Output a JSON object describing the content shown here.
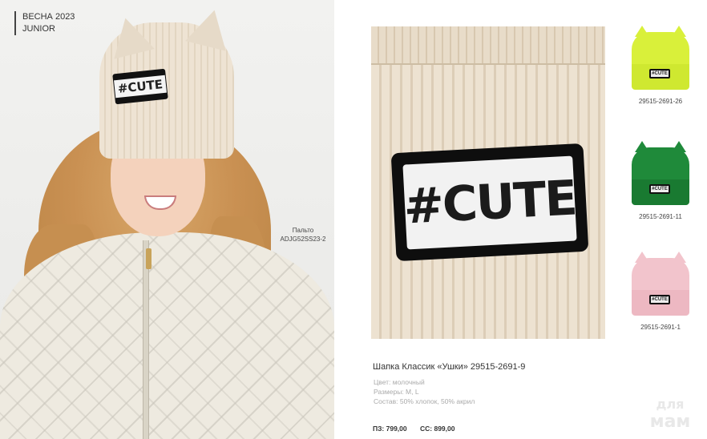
{
  "season": {
    "line1": "ВЕСНА 2023",
    "line2": "JUNIOR"
  },
  "coat_label": {
    "line1": "Пальто",
    "line2": "ADJG52SS23-2"
  },
  "hat_patch_text": "#CUTE",
  "detail_patch_text": "#CUTE",
  "product": {
    "title": "Шапка Классик «Ушки» 29515-2691-9",
    "color": "Цвет: молочный",
    "sizes": "Размеры: M, L",
    "composition": "Состав: 50% хлопок, 50% акрил",
    "price_pz": "ПЗ: 799,00",
    "price_ss": "СС: 899,00"
  },
  "variants": [
    {
      "code": "29515-2691-26",
      "color": "#d9f03a",
      "cuff_color": "#cfe830",
      "patch": "#CUTE"
    },
    {
      "code": "29515-2691-11",
      "color": "#1f8a3a",
      "cuff_color": "#197a31",
      "patch": "#CUTE"
    },
    {
      "code": "29515-2691-1",
      "color": "#f2c4cc",
      "cuff_color": "#edb8c2",
      "patch": "#CUTE"
    }
  ],
  "watermark": {
    "line1": "для",
    "line2": "мам"
  }
}
